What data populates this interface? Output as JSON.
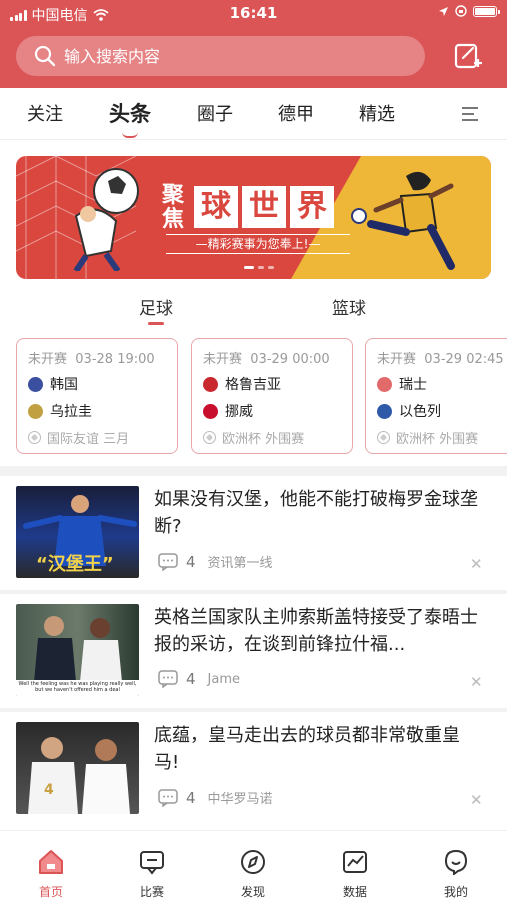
{
  "status_bar": {
    "carrier": "中国电信",
    "time": "16:41"
  },
  "search": {
    "placeholder": "输入搜索内容"
  },
  "nav_tabs": [
    {
      "label": "关注"
    },
    {
      "label": "头条",
      "active": true
    },
    {
      "label": "圈子"
    },
    {
      "label": "德甲"
    },
    {
      "label": "精选"
    }
  ],
  "banner": {
    "side_text": "聚焦",
    "title_chars": [
      "球",
      "世",
      "界"
    ],
    "subtitle": "—精彩赛事为您奉上!—"
  },
  "sport_tabs": [
    {
      "label": "足球",
      "active": true
    },
    {
      "label": "篮球"
    }
  ],
  "matches": [
    {
      "status": "未开赛",
      "datetime": "03-28 19:00",
      "home": {
        "name": "韩国",
        "color": "#3a4fa0"
      },
      "away": {
        "name": "乌拉圭",
        "color": "#c0a040"
      },
      "league": "国际友谊 三月"
    },
    {
      "status": "未开赛",
      "datetime": "03-29 00:00",
      "home": {
        "name": "格鲁吉亚",
        "color": "#c8282e"
      },
      "away": {
        "name": "挪威",
        "color": "#c8102e"
      },
      "league": "欧洲杯 外围赛"
    },
    {
      "status": "未开赛",
      "datetime": "03-29 02:45",
      "home": {
        "name": "瑞士",
        "color": "#e36a6a"
      },
      "away": {
        "name": "以色列",
        "color": "#2f5aa8"
      },
      "league": "欧洲杯 外围赛"
    }
  ],
  "news": [
    {
      "headline": "如果没有汉堡，他能不能打破梅罗金球垄断?",
      "comments": "4",
      "source": "资讯第一线",
      "thumb_caption": "“汉堡王”"
    },
    {
      "headline": "英格兰国家队主帅索斯盖特接受了泰晤士报的采访，在谈到前锋拉什福...",
      "comments": "4",
      "source": "Jame",
      "thumb_caption": "Well the feeling was he was playing really well, but we haven't offered him a deal"
    },
    {
      "headline": "底蕴，皇马走出去的球员都非常敬重皇马!",
      "comments": "4",
      "source": "中华罗马诺"
    }
  ],
  "tabbar": [
    {
      "label": "首页",
      "icon": "home-icon",
      "active": true
    },
    {
      "label": "比赛",
      "icon": "match-icon"
    },
    {
      "label": "发现",
      "icon": "discover-icon"
    },
    {
      "label": "数据",
      "icon": "data-icon"
    },
    {
      "label": "我的",
      "icon": "profile-icon"
    }
  ],
  "colors": {
    "accent": "#db5456",
    "banner_red": "#d9473f",
    "banner_yellow": "#efb737"
  }
}
